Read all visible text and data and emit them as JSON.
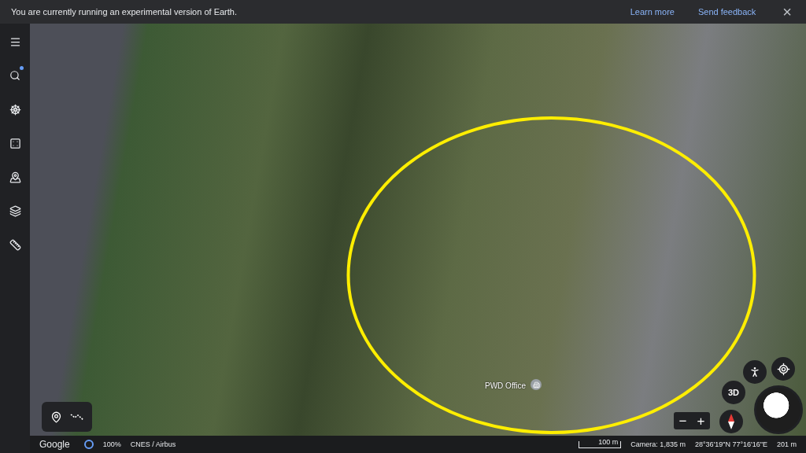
{
  "banner": {
    "message": "You are currently running an experimental version of Earth.",
    "links": [
      "Learn more",
      "Send feedback"
    ],
    "close": "×"
  },
  "sidebar": {
    "items": [
      {
        "badge": false
      },
      {
        "badge": true
      },
      {
        "badge": false
      },
      {
        "badge": false
      },
      {
        "badge": false
      },
      {
        "badge": false
      },
      {
        "badge": false
      }
    ]
  },
  "map": {
    "places": [
      "PWD Office"
    ]
  },
  "controls": {
    "view_mode": "3D",
    "zoom_out": "−",
    "zoom_in": "+"
  },
  "status_bar": {
    "brand": "Google",
    "loading": "100%",
    "imagery": "CNES / Airbus",
    "scale": "100 m",
    "camera": "Camera: 1,835 m",
    "coordinates": "28°36'19\"N 77°16'16\"E",
    "elevation": "201 m"
  }
}
